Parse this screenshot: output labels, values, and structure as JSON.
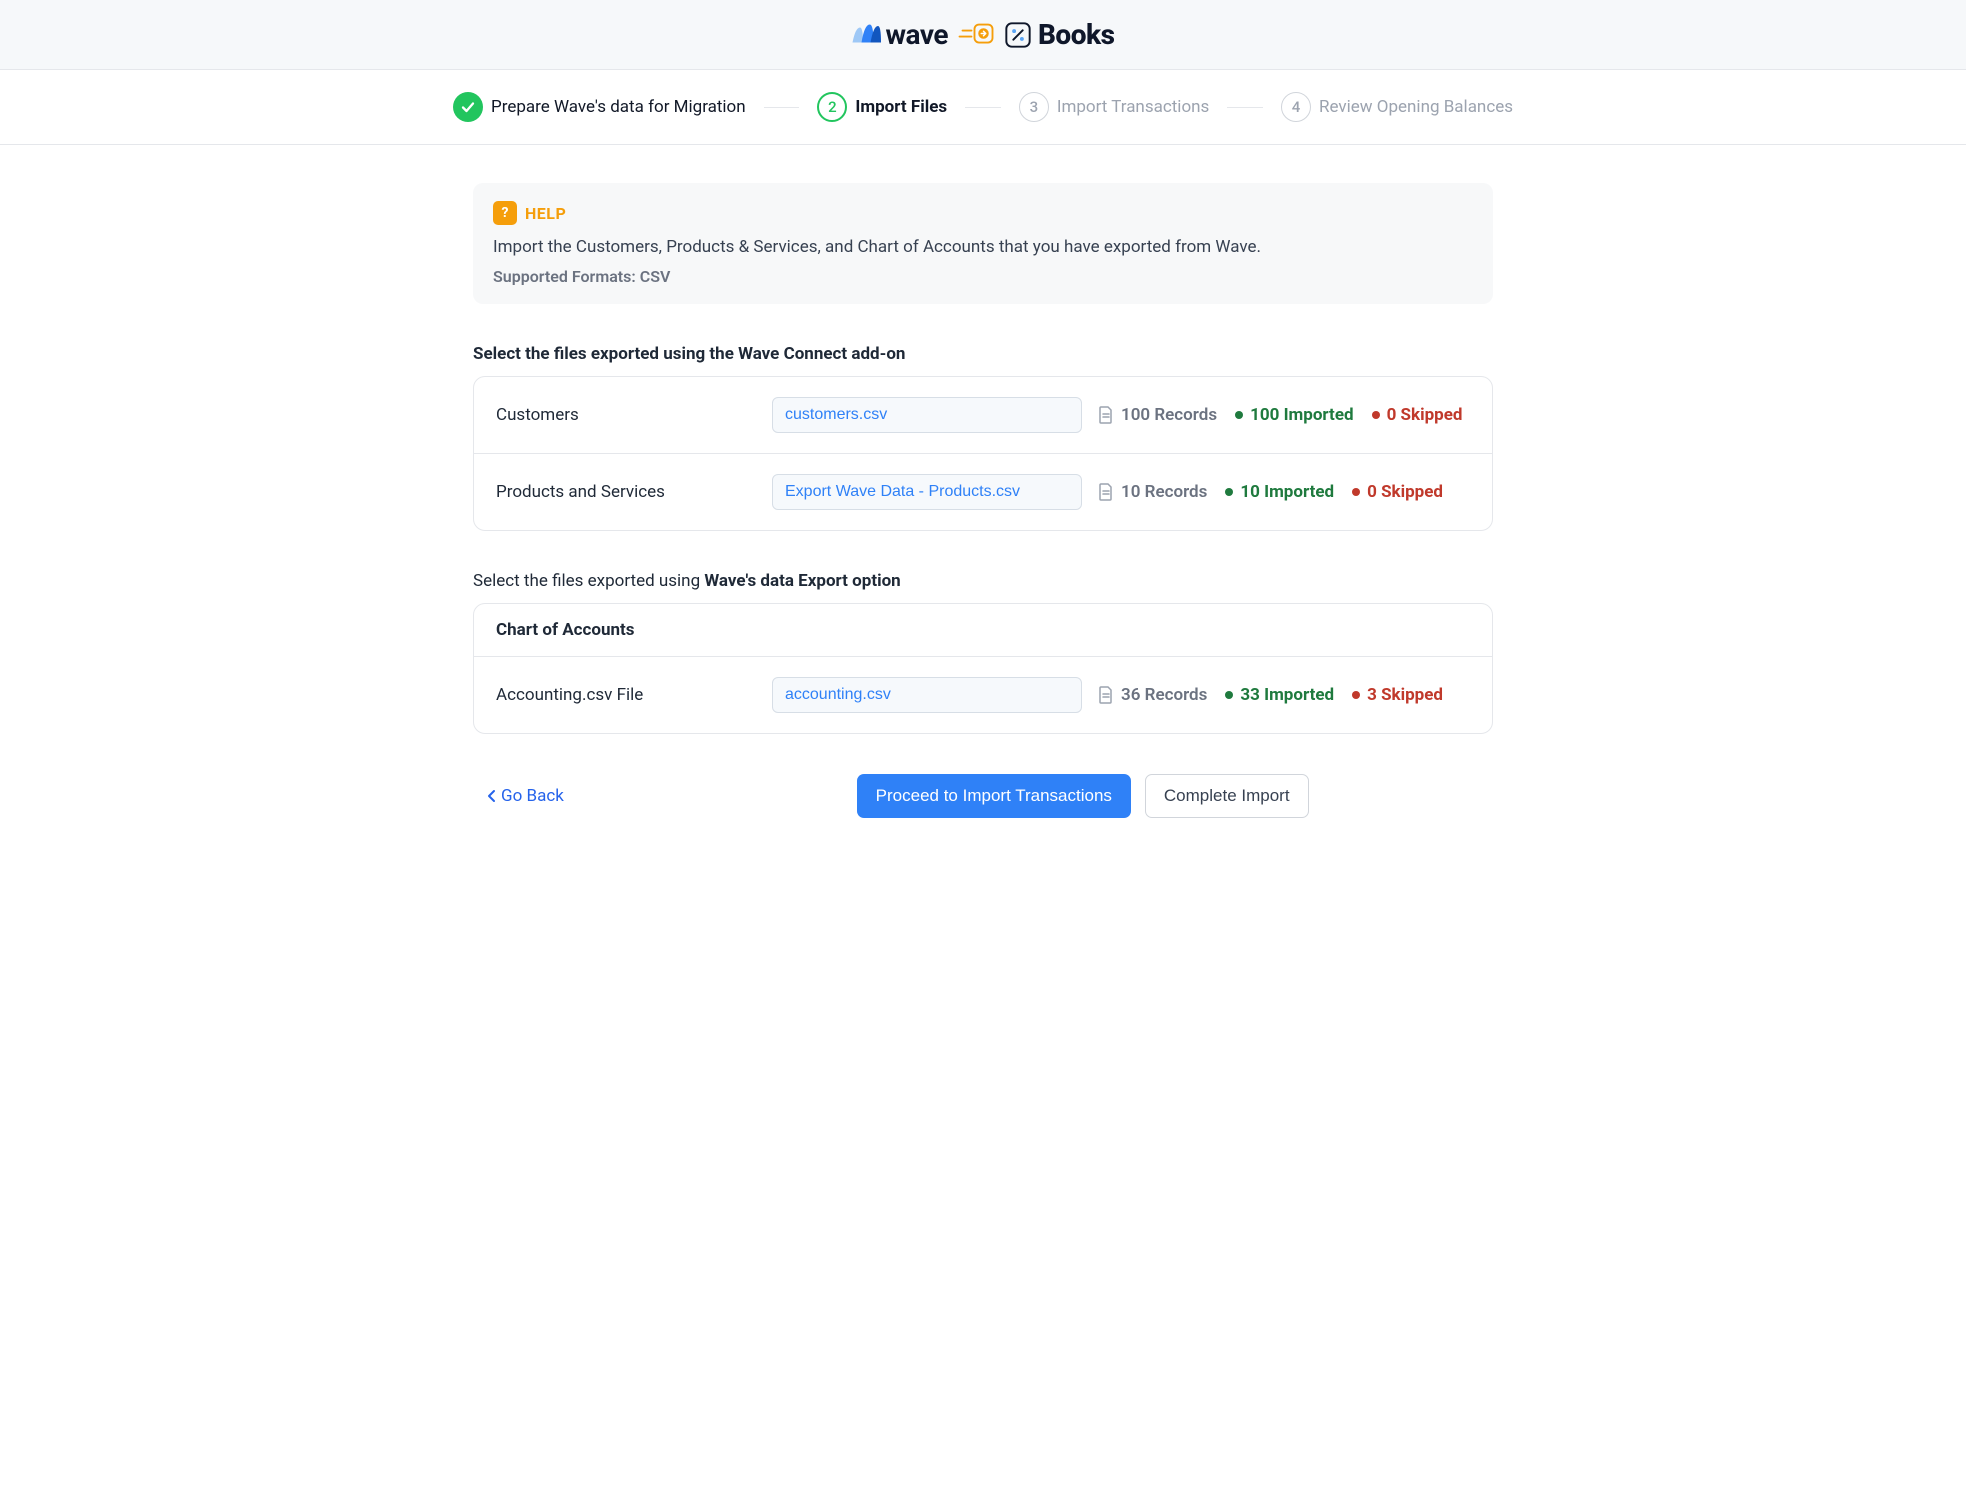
{
  "brand": {
    "wave": "wave",
    "books": "Books"
  },
  "steps": [
    {
      "label": "Prepare Wave's data for Migration",
      "state": "done"
    },
    {
      "label": "Import Files",
      "state": "active",
      "num": "2"
    },
    {
      "label": "Import Transactions",
      "state": "pending",
      "num": "3"
    },
    {
      "label": "Review Opening Balances",
      "state": "pending",
      "num": "4"
    }
  ],
  "help": {
    "badge": "?",
    "title": "HELP",
    "text": "Import the Customers, Products & Services, and Chart of Accounts that you have exported from Wave.",
    "sub": "Supported Formats: CSV"
  },
  "section1_title": "Select the files exported using the Wave Connect add-on",
  "section2_title_prefix": "Select the files exported using ",
  "section2_title_bold": "Wave's data Export option",
  "rows1": [
    {
      "label": "Customers",
      "file": "customers.csv",
      "records": "100 Records",
      "imported": "100 Imported",
      "skipped": "0 Skipped"
    },
    {
      "label": "Products and Services",
      "file": "Export Wave Data - Products.csv",
      "records": "10 Records",
      "imported": "10 Imported",
      "skipped": "0 Skipped"
    }
  ],
  "panel2_header": "Chart of Accounts",
  "rows2": [
    {
      "label": "Accounting.csv File",
      "file": "accounting.csv",
      "records": "36 Records",
      "imported": "33 Imported",
      "skipped": "3 Skipped"
    }
  ],
  "footer": {
    "goback": "Go Back",
    "primary": "Proceed to Import Transactions",
    "secondary": "Complete Import"
  }
}
